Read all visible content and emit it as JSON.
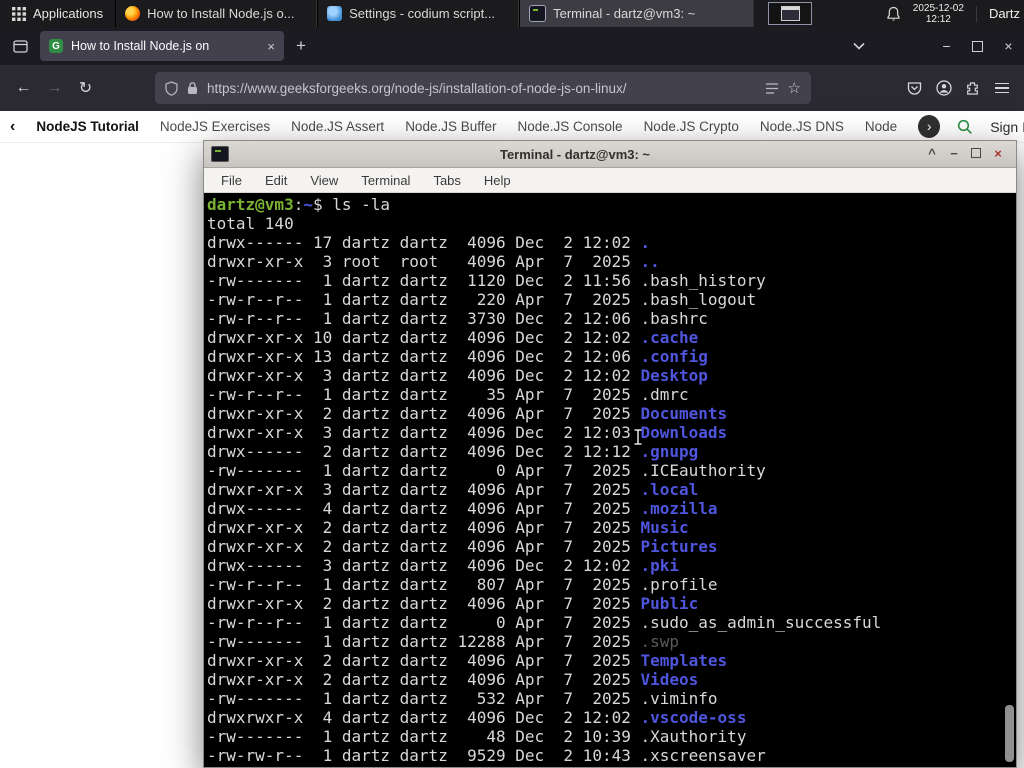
{
  "icons": {
    "new_tab": "+",
    "tab_close": "×",
    "window_close": "×",
    "window_minimize": "−",
    "back": "←",
    "forward": "→",
    "refresh": "↻",
    "star": "☆",
    "chevron_left": "‹",
    "chevron_right": "›",
    "shade": "^",
    "favicon_letter": "G"
  },
  "colors": {
    "gfg_green": "#2f8d46",
    "terminal_dir_blue": "#4f55dd",
    "terminal_prompt_green": "#7ab332",
    "panel_bg": "#1b1b1d",
    "browser_toolbar": "#2b2a33"
  },
  "panel": {
    "applications_label": "Applications",
    "tasks": [
      {
        "title": "How to Install Node.js o...",
        "icon": "firefox"
      },
      {
        "title": "Settings - codium script...",
        "icon": "codium"
      },
      {
        "title": "Terminal - dartz@vm3: ~",
        "icon": "terminal"
      }
    ],
    "clock": {
      "date": "2025-12-02",
      "time": "12:12"
    },
    "user": "Dartz"
  },
  "browser": {
    "tab": {
      "title": "How to Install Node.js on"
    },
    "url": "https://www.geeksforgeeks.org/node-js/installation-of-node-js-on-linux/",
    "site_nav": {
      "items": [
        "NodeJS Tutorial",
        "NodeJS Exercises",
        "Node.JS Assert",
        "Node.JS Buffer",
        "Node.JS Console",
        "Node.JS Crypto",
        "Node.JS DNS",
        "Node"
      ],
      "sign_in": "Sign In"
    }
  },
  "terminal": {
    "title": "Terminal - dartz@vm3: ~",
    "menu": [
      "File",
      "Edit",
      "View",
      "Terminal",
      "Tabs",
      "Help"
    ],
    "prompt": {
      "user_host": "dartz@vm3",
      "separator": ":",
      "path": "~",
      "symbol": "$",
      "command": " ls -la"
    },
    "total_line": "total 140",
    "files": [
      {
        "perms": "drwx------",
        "links": "17",
        "owner": "dartz",
        "group": "dartz",
        "size": "4096",
        "month": "Dec",
        "day": "2",
        "time": "12:02",
        "name": ".",
        "style": "dir"
      },
      {
        "perms": "drwxr-xr-x",
        "links": "3",
        "owner": "root",
        "group": "root",
        "size": "4096",
        "month": "Apr",
        "day": "7",
        "time": "2025",
        "name": "..",
        "style": "dir"
      },
      {
        "perms": "-rw-------",
        "links": "1",
        "owner": "dartz",
        "group": "dartz",
        "size": "1120",
        "month": "Dec",
        "day": "2",
        "time": "11:56",
        "name": ".bash_history",
        "style": "file"
      },
      {
        "perms": "-rw-r--r--",
        "links": "1",
        "owner": "dartz",
        "group": "dartz",
        "size": "220",
        "month": "Apr",
        "day": "7",
        "time": "2025",
        "name": ".bash_logout",
        "style": "file"
      },
      {
        "perms": "-rw-r--r--",
        "links": "1",
        "owner": "dartz",
        "group": "dartz",
        "size": "3730",
        "month": "Dec",
        "day": "2",
        "time": "12:06",
        "name": ".bashrc",
        "style": "file"
      },
      {
        "perms": "drwxr-xr-x",
        "links": "10",
        "owner": "dartz",
        "group": "dartz",
        "size": "4096",
        "month": "Dec",
        "day": "2",
        "time": "12:02",
        "name": ".cache",
        "style": "dir"
      },
      {
        "perms": "drwxr-xr-x",
        "links": "13",
        "owner": "dartz",
        "group": "dartz",
        "size": "4096",
        "month": "Dec",
        "day": "2",
        "time": "12:06",
        "name": ".config",
        "style": "dir"
      },
      {
        "perms": "drwxr-xr-x",
        "links": "3",
        "owner": "dartz",
        "group": "dartz",
        "size": "4096",
        "month": "Dec",
        "day": "2",
        "time": "12:02",
        "name": "Desktop",
        "style": "dir"
      },
      {
        "perms": "-rw-r--r--",
        "links": "1",
        "owner": "dartz",
        "group": "dartz",
        "size": "35",
        "month": "Apr",
        "day": "7",
        "time": "2025",
        "name": ".dmrc",
        "style": "file"
      },
      {
        "perms": "drwxr-xr-x",
        "links": "2",
        "owner": "dartz",
        "group": "dartz",
        "size": "4096",
        "month": "Apr",
        "day": "7",
        "time": "2025",
        "name": "Documents",
        "style": "dir"
      },
      {
        "perms": "drwxr-xr-x",
        "links": "3",
        "owner": "dartz",
        "group": "dartz",
        "size": "4096",
        "month": "Dec",
        "day": "2",
        "time": "12:03",
        "name": "Downloads",
        "style": "dir"
      },
      {
        "perms": "drwx------",
        "links": "2",
        "owner": "dartz",
        "group": "dartz",
        "size": "4096",
        "month": "Dec",
        "day": "2",
        "time": "12:12",
        "name": ".gnupg",
        "style": "dir"
      },
      {
        "perms": "-rw-------",
        "links": "1",
        "owner": "dartz",
        "group": "dartz",
        "size": "0",
        "month": "Apr",
        "day": "7",
        "time": "2025",
        "name": ".ICEauthority",
        "style": "file"
      },
      {
        "perms": "drwxr-xr-x",
        "links": "3",
        "owner": "dartz",
        "group": "dartz",
        "size": "4096",
        "month": "Apr",
        "day": "7",
        "time": "2025",
        "name": ".local",
        "style": "dir"
      },
      {
        "perms": "drwx------",
        "links": "4",
        "owner": "dartz",
        "group": "dartz",
        "size": "4096",
        "month": "Apr",
        "day": "7",
        "time": "2025",
        "name": ".mozilla",
        "style": "dir"
      },
      {
        "perms": "drwxr-xr-x",
        "links": "2",
        "owner": "dartz",
        "group": "dartz",
        "size": "4096",
        "month": "Apr",
        "day": "7",
        "time": "2025",
        "name": "Music",
        "style": "dir"
      },
      {
        "perms": "drwxr-xr-x",
        "links": "2",
        "owner": "dartz",
        "group": "dartz",
        "size": "4096",
        "month": "Apr",
        "day": "7",
        "time": "2025",
        "name": "Pictures",
        "style": "dir"
      },
      {
        "perms": "drwx------",
        "links": "3",
        "owner": "dartz",
        "group": "dartz",
        "size": "4096",
        "month": "Dec",
        "day": "2",
        "time": "12:02",
        "name": ".pki",
        "style": "dir"
      },
      {
        "perms": "-rw-r--r--",
        "links": "1",
        "owner": "dartz",
        "group": "dartz",
        "size": "807",
        "month": "Apr",
        "day": "7",
        "time": "2025",
        "name": ".profile",
        "style": "file"
      },
      {
        "perms": "drwxr-xr-x",
        "links": "2",
        "owner": "dartz",
        "group": "dartz",
        "size": "4096",
        "month": "Apr",
        "day": "7",
        "time": "2025",
        "name": "Public",
        "style": "dir"
      },
      {
        "perms": "-rw-r--r--",
        "links": "1",
        "owner": "dartz",
        "group": "dartz",
        "size": "0",
        "month": "Apr",
        "day": "7",
        "time": "2025",
        "name": ".sudo_as_admin_successful",
        "style": "file"
      },
      {
        "perms": "-rw-------",
        "links": "1",
        "owner": "dartz",
        "group": "dartz",
        "size": "12288",
        "month": "Apr",
        "day": "7",
        "time": "2025",
        "name": ".swp",
        "style": "dim"
      },
      {
        "perms": "drwxr-xr-x",
        "links": "2",
        "owner": "dartz",
        "group": "dartz",
        "size": "4096",
        "month": "Apr",
        "day": "7",
        "time": "2025",
        "name": "Templates",
        "style": "dir"
      },
      {
        "perms": "drwxr-xr-x",
        "links": "2",
        "owner": "dartz",
        "group": "dartz",
        "size": "4096",
        "month": "Apr",
        "day": "7",
        "time": "2025",
        "name": "Videos",
        "style": "dir"
      },
      {
        "perms": "-rw-------",
        "links": "1",
        "owner": "dartz",
        "group": "dartz",
        "size": "532",
        "month": "Apr",
        "day": "7",
        "time": "2025",
        "name": ".viminfo",
        "style": "file"
      },
      {
        "perms": "drwxrwxr-x",
        "links": "4",
        "owner": "dartz",
        "group": "dartz",
        "size": "4096",
        "month": "Dec",
        "day": "2",
        "time": "12:02",
        "name": ".vscode-oss",
        "style": "dir"
      },
      {
        "perms": "-rw-------",
        "links": "1",
        "owner": "dartz",
        "group": "dartz",
        "size": "48",
        "month": "Dec",
        "day": "2",
        "time": "10:39",
        "name": ".Xauthority",
        "style": "file"
      },
      {
        "perms": "-rw-rw-r--",
        "links": "1",
        "owner": "dartz",
        "group": "dartz",
        "size": "9529",
        "month": "Dec",
        "day": "2",
        "time": "10:43",
        "name": ".xscreensaver",
        "style": "file"
      }
    ]
  }
}
